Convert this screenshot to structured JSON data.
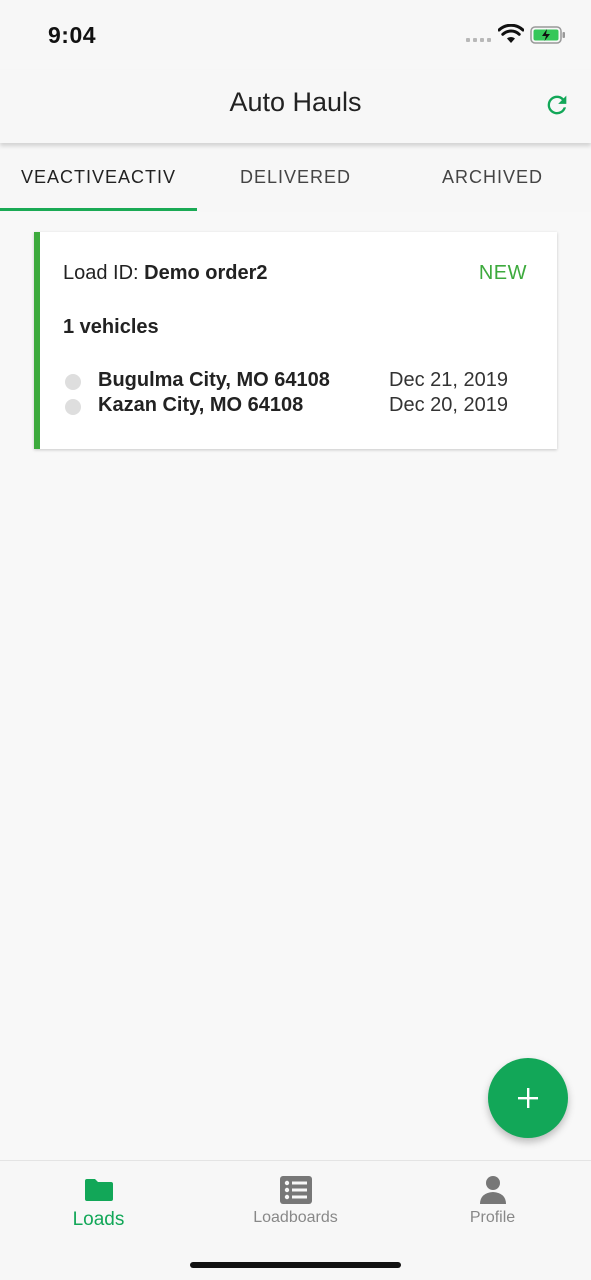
{
  "status_bar": {
    "time": "9:04"
  },
  "header": {
    "title": "Auto Hauls"
  },
  "tabs": [
    {
      "label": "VEACTIVEACTIV",
      "active": true
    },
    {
      "label": "DELIVERED",
      "active": false
    },
    {
      "label": "ARCHIVED",
      "active": false
    }
  ],
  "load_card": {
    "id_label": "Load ID:",
    "id_value": "Demo order2",
    "status": "NEW",
    "vehicles": "1 vehicles",
    "stops": [
      {
        "city": "Bugulma City, MO 64108",
        "date": "Dec 21, 2019"
      },
      {
        "city": "Kazan City, MO 64108",
        "date": "Dec 20, 2019"
      }
    ]
  },
  "bottom_nav": [
    {
      "label": "Loads",
      "icon": "folder-icon",
      "active": true
    },
    {
      "label": "Loadboards",
      "icon": "list-icon",
      "active": false
    },
    {
      "label": "Profile",
      "icon": "person-icon",
      "active": false
    }
  ],
  "colors": {
    "accent": "#12a758",
    "status_new": "#3daa3d"
  }
}
